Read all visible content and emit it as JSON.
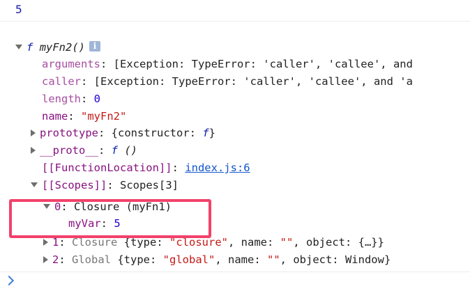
{
  "result_value": "5",
  "function": {
    "f_glyph": "f",
    "name": "myFn2()",
    "info_icon_glyph": "i",
    "properties": {
      "arguments": {
        "key": "arguments",
        "value": "[Exception: TypeError: 'caller', 'callee', and"
      },
      "caller": {
        "key": "caller",
        "value": "[Exception: TypeError: 'caller', 'callee', and 'a"
      },
      "length": {
        "key": "length",
        "value": "0"
      },
      "name": {
        "key": "name",
        "value": "\"myFn2\""
      },
      "prototype": {
        "key": "prototype",
        "value_pre": "{constructor: ",
        "value_f": "f",
        "value_post": "}"
      },
      "proto": {
        "key": "__proto__",
        "value_f": "f",
        "value_post": " ()"
      },
      "function_location": {
        "key": "[[FunctionLocation]]",
        "link": "index.js:6"
      },
      "scopes": {
        "key": "[[Scopes]]",
        "value": "Scopes[3]"
      }
    },
    "scopes": [
      {
        "index": "0",
        "label": "Closure (myFn1)",
        "var_key": "myVar",
        "var_value": "5"
      },
      {
        "index": "1",
        "kind": "Closure",
        "pre": " {type: ",
        "type": "\"closure\"",
        "mid": ", name: ",
        "name": "\"\"",
        "post": ", object: {…}}"
      },
      {
        "index": "2",
        "kind": "Global",
        "pre": " {type: ",
        "type": "\"global\"",
        "mid": ", name: ",
        "name": "\"\"",
        "post": ", object: Window}"
      }
    ]
  },
  "colors": {
    "highlight_border": "#f2416b",
    "property_key": "#881280",
    "number": "#1c00cf",
    "string": "#c41a16"
  }
}
